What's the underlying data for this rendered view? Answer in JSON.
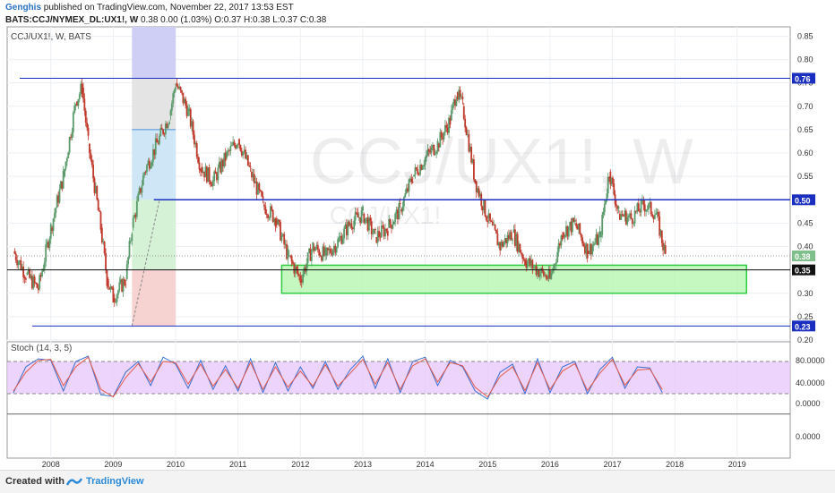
{
  "header": {
    "author": "Genghis",
    "published": "published on TradingView.com, November 22, 2017 13:53 EST",
    "symbol_line": "BATS:CCJ/NYMEX_DL:UX1!, W",
    "quote": "0.38 0.00 (1.03%) O:0.37 H:0.38 L:0.37 C:0.38"
  },
  "footer": {
    "created_with": "Created with",
    "brand": "TradingView"
  },
  "colors": {
    "up": "#5b9b6b",
    "down": "#c0392b",
    "blue_line": "#1a2fbf",
    "zone_fill": "#b6f5b0",
    "zone_stroke": "#2ecc40",
    "stoch_fill": "#e7c9fb",
    "k_line": "#3b6fd0",
    "d_line": "#e55b4d"
  },
  "chart_data": [
    {
      "type": "candlestick",
      "pane_label": "CCJ/UX1!, W, BATS",
      "watermark": "CCJ/UX1!, W",
      "watermark_sub": "CCJ/UX1!",
      "x_ticks": [
        "2008",
        "2009",
        "2010",
        "2011",
        "2012",
        "2013",
        "2014",
        "2015",
        "2016",
        "2017",
        "2018",
        "2019"
      ],
      "xlim": [
        2007.3,
        2019.85
      ],
      "ylim": [
        0.2,
        0.87
      ],
      "y_ticks": [
        "0.85",
        "0.80",
        "0.75",
        "0.70",
        "0.65",
        "0.60",
        "0.55",
        "0.50",
        "0.45",
        "0.40",
        "0.30",
        "0.25",
        "0.20"
      ],
      "price_labels": [
        {
          "value": 0.76,
          "text": "0.76",
          "style": "blue"
        },
        {
          "value": 0.5,
          "text": "0.50",
          "style": "blue"
        },
        {
          "value": 0.38,
          "text": "0.38",
          "style": "green"
        },
        {
          "value": 0.35,
          "text": "0.35",
          "style": "black"
        },
        {
          "value": 0.23,
          "text": "0.23",
          "style": "blue"
        }
      ],
      "horizontal_lines": [
        {
          "value": 0.76,
          "from": 2007.5,
          "color": "blue"
        },
        {
          "value": 0.5,
          "from": 2009.65,
          "color": "blue"
        },
        {
          "value": 0.35,
          "from": 2007.3,
          "color": "black"
        },
        {
          "value": 0.23,
          "from": 2007.7,
          "color": "blue"
        },
        {
          "value": 0.38,
          "from": 2007.3,
          "color": "dotted"
        }
      ],
      "support_zone": {
        "x_from": 2011.7,
        "x_to": 2019.15,
        "y_from": 0.3,
        "y_to": 0.36
      },
      "projection": {
        "x_from": 2009.3,
        "x_to": 2010.0,
        "entry": 0.5,
        "target": 0.65,
        "stop": 0.35,
        "top": 0.87,
        "bottom": 0.23
      },
      "series": [
        {
          "name": "close",
          "x": [
            2007.4,
            2007.6,
            2007.8,
            2008.0,
            2008.2,
            2008.4,
            2008.5,
            2008.6,
            2008.8,
            2008.9,
            2009.0,
            2009.2,
            2009.3,
            2009.5,
            2009.7,
            2009.9,
            2010.0,
            2010.2,
            2010.4,
            2010.6,
            2010.8,
            2011.0,
            2011.2,
            2011.4,
            2011.6,
            2011.8,
            2012.0,
            2012.2,
            2012.4,
            2012.6,
            2012.8,
            2013.0,
            2013.2,
            2013.4,
            2013.6,
            2013.8,
            2014.0,
            2014.2,
            2014.4,
            2014.5,
            2014.6,
            2014.8,
            2015.0,
            2015.2,
            2015.4,
            2015.6,
            2015.8,
            2016.0,
            2016.2,
            2016.4,
            2016.6,
            2016.8,
            2016.95,
            2017.1,
            2017.3,
            2017.5,
            2017.7,
            2017.85
          ],
          "y": [
            0.39,
            0.34,
            0.31,
            0.44,
            0.55,
            0.71,
            0.74,
            0.62,
            0.44,
            0.33,
            0.29,
            0.33,
            0.44,
            0.56,
            0.62,
            0.68,
            0.75,
            0.69,
            0.57,
            0.54,
            0.59,
            0.63,
            0.56,
            0.49,
            0.46,
            0.38,
            0.33,
            0.4,
            0.38,
            0.41,
            0.45,
            0.47,
            0.42,
            0.44,
            0.48,
            0.55,
            0.59,
            0.62,
            0.67,
            0.73,
            0.7,
            0.54,
            0.46,
            0.4,
            0.43,
            0.37,
            0.35,
            0.33,
            0.43,
            0.45,
            0.39,
            0.42,
            0.56,
            0.47,
            0.46,
            0.49,
            0.47,
            0.38
          ]
        }
      ]
    },
    {
      "type": "line",
      "pane_label": "Stoch (14, 3, 5)",
      "ylim": [
        -100,
        100
      ],
      "y_ticks": [
        "80.0000",
        "40.0000",
        "0.0000",
        "0.0000"
      ],
      "bands": [
        80,
        20
      ],
      "series": [
        {
          "name": "%K",
          "x": [
            2007.4,
            2007.6,
            2007.8,
            2008.0,
            2008.2,
            2008.4,
            2008.6,
            2008.8,
            2009.0,
            2009.2,
            2009.4,
            2009.6,
            2009.8,
            2010.0,
            2010.2,
            2010.4,
            2010.6,
            2010.8,
            2011.0,
            2011.2,
            2011.4,
            2011.6,
            2011.8,
            2012.0,
            2012.2,
            2012.4,
            2012.6,
            2012.8,
            2013.0,
            2013.2,
            2013.4,
            2013.6,
            2013.8,
            2014.0,
            2014.2,
            2014.4,
            2014.6,
            2014.8,
            2015.0,
            2015.2,
            2015.4,
            2015.6,
            2015.8,
            2016.0,
            2016.2,
            2016.4,
            2016.6,
            2016.8,
            2017.0,
            2017.2,
            2017.4,
            2017.6,
            2017.8
          ],
          "y": [
            22,
            70,
            85,
            82,
            25,
            80,
            90,
            18,
            15,
            60,
            80,
            35,
            88,
            75,
            30,
            82,
            28,
            72,
            25,
            85,
            22,
            78,
            25,
            70,
            30,
            80,
            28,
            65,
            90,
            30,
            85,
            22,
            80,
            88,
            35,
            82,
            70,
            25,
            10,
            60,
            75,
            20,
            85,
            22,
            70,
            80,
            20,
            65,
            88,
            30,
            70,
            68,
            22
          ]
        },
        {
          "name": "%D",
          "x": [
            2007.4,
            2007.6,
            2007.8,
            2008.0,
            2008.2,
            2008.4,
            2008.6,
            2008.8,
            2009.0,
            2009.2,
            2009.4,
            2009.6,
            2009.8,
            2010.0,
            2010.2,
            2010.4,
            2010.6,
            2010.8,
            2011.0,
            2011.2,
            2011.4,
            2011.6,
            2011.8,
            2012.0,
            2012.2,
            2012.4,
            2012.6,
            2012.8,
            2013.0,
            2013.2,
            2013.4,
            2013.6,
            2013.8,
            2014.0,
            2014.2,
            2014.4,
            2014.6,
            2014.8,
            2015.0,
            2015.2,
            2015.4,
            2015.6,
            2015.8,
            2016.0,
            2016.2,
            2016.4,
            2016.6,
            2016.8,
            2017.0,
            2017.2,
            2017.4,
            2017.6,
            2017.8
          ],
          "y": [
            25,
            60,
            82,
            84,
            35,
            70,
            88,
            28,
            14,
            50,
            76,
            42,
            80,
            78,
            38,
            75,
            34,
            65,
            30,
            78,
            28,
            70,
            32,
            62,
            34,
            74,
            34,
            58,
            84,
            38,
            78,
            28,
            72,
            85,
            42,
            78,
            72,
            32,
            14,
            52,
            70,
            26,
            78,
            28,
            62,
            76,
            26,
            58,
            84,
            36,
            64,
            66,
            28
          ]
        }
      ]
    }
  ]
}
